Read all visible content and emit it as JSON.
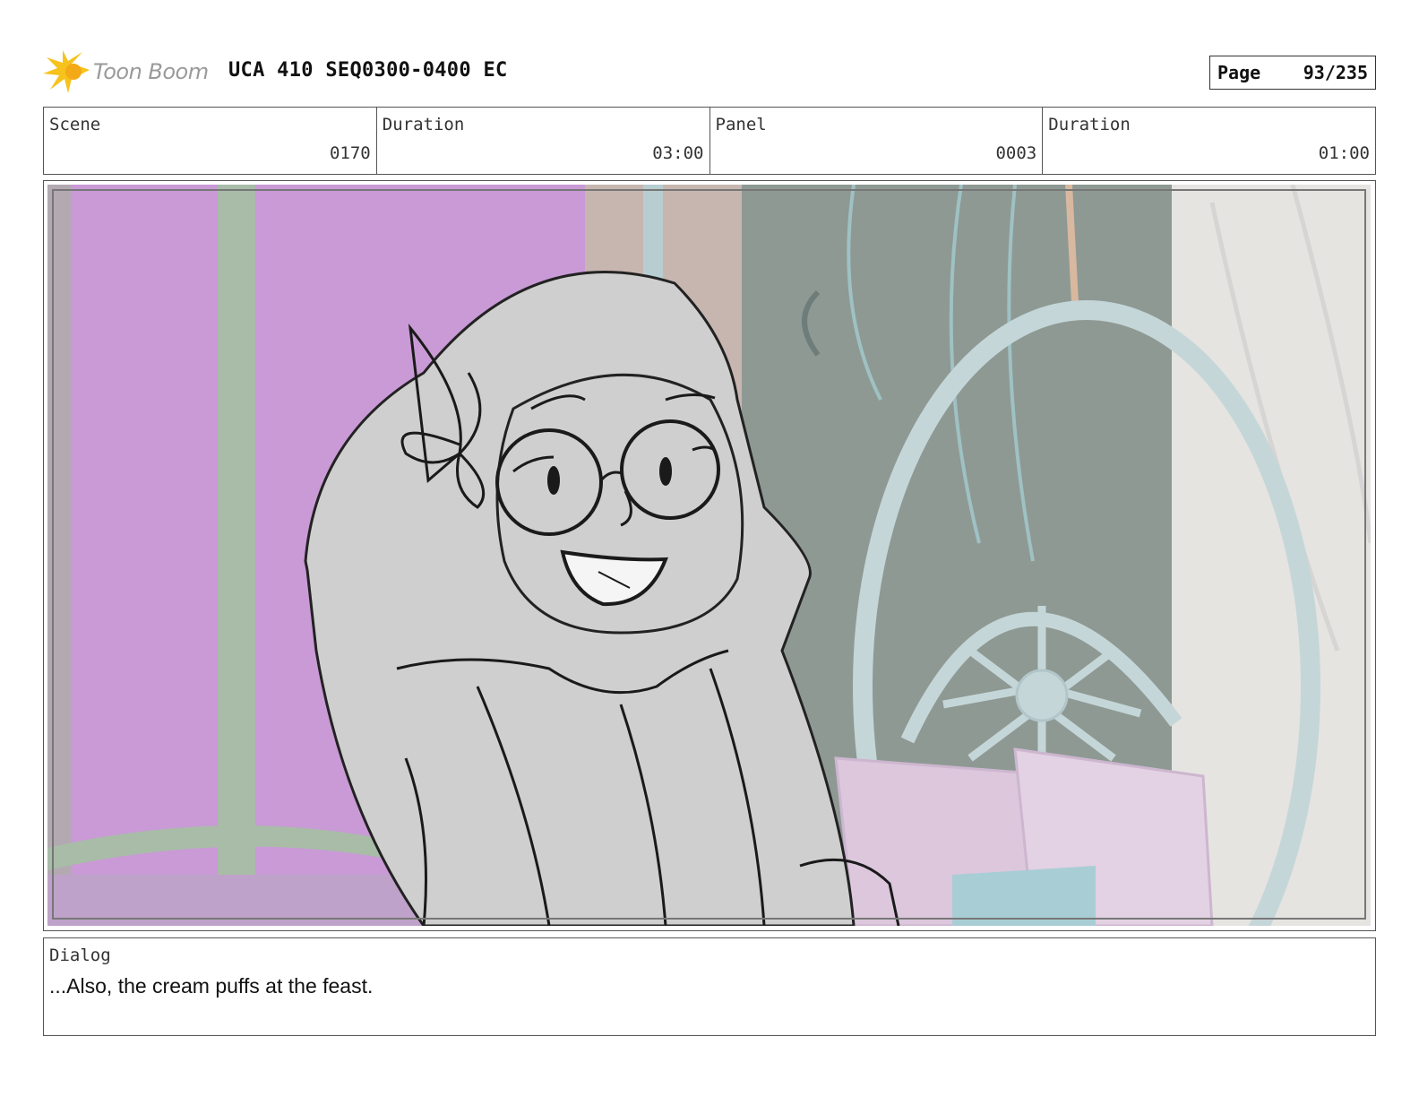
{
  "header": {
    "brand": "Toon Boom",
    "title": "UCA 410 SEQ0300-0400 EC",
    "page_label": "Page",
    "page_number": "93/235"
  },
  "info": {
    "scene_label": "Scene",
    "scene_value": "0170",
    "scene_duration_label": "Duration",
    "scene_duration_value": "03:00",
    "panel_label": "Panel",
    "panel_value": "0003",
    "panel_duration_label": "Duration",
    "panel_duration_value": "01:00"
  },
  "panel": {
    "image_icon": "storyboard-sketch"
  },
  "dialog": {
    "label": "Dialog",
    "text": "...Also, the cream puffs at the feast."
  },
  "colors": {
    "logo_yellow": "#f6c21c",
    "window_purple": "#c99ad6",
    "back_wall_grey": "#8e9994",
    "sketch_fill": "#cfcfcf",
    "chair_blue": "#c5d6d8",
    "pillow_pink": "#dcc7dd"
  }
}
